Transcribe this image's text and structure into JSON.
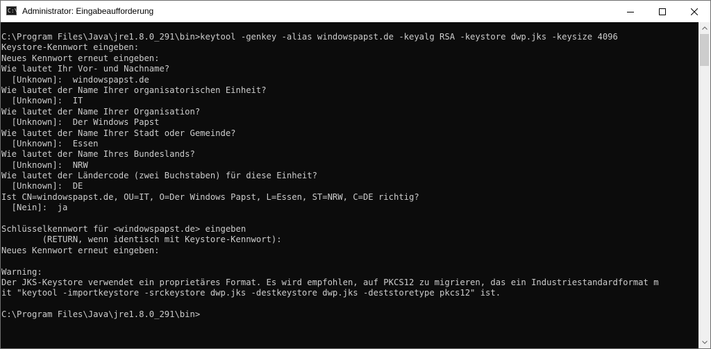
{
  "window": {
    "title": "Administrator: Eingabeaufforderung",
    "icon": "cmd-icon",
    "controls": [
      "minimize-icon",
      "maximize-icon",
      "close-icon"
    ]
  },
  "colors": {
    "console_bg": "#0c0c0c",
    "console_fg": "#cccccc",
    "titlebar_bg": "#ffffff",
    "scrollbar_bg": "#f0f0f0",
    "scrollbar_thumb": "#cdcdcd"
  },
  "console": {
    "lines": [
      "C:\\Program Files\\Java\\jre1.8.0_291\\bin>keytool -genkey -alias windowspapst.de -keyalg RSA -keystore dwp.jks -keysize 4096",
      "Keystore-Kennwort eingeben:",
      "Neues Kennwort erneut eingeben:",
      "Wie lautet Ihr Vor- und Nachname?",
      "  [Unknown]:  windowspapst.de",
      "Wie lautet der Name Ihrer organisatorischen Einheit?",
      "  [Unknown]:  IT",
      "Wie lautet der Name Ihrer Organisation?",
      "  [Unknown]:  Der Windows Papst",
      "Wie lautet der Name Ihrer Stadt oder Gemeinde?",
      "  [Unknown]:  Essen",
      "Wie lautet der Name Ihres Bundeslands?",
      "  [Unknown]:  NRW",
      "Wie lautet der Ländercode (zwei Buchstaben) für diese Einheit?",
      "  [Unknown]:  DE",
      "Ist CN=windowspapst.de, OU=IT, O=Der Windows Papst, L=Essen, ST=NRW, C=DE richtig?",
      "  [Nein]:  ja",
      "",
      "Schlüsselkennwort für <windowspapst.de> eingeben",
      "        (RETURN, wenn identisch mit Keystore-Kennwort):",
      "Neues Kennwort erneut eingeben:",
      "",
      "Warning:",
      "Der JKS-Keystore verwendet ein proprietäres Format. Es wird empfohlen, auf PKCS12 zu migrieren, das ein Industriestandardformat m",
      "it \"keytool -importkeystore -srckeystore dwp.jks -destkeystore dwp.jks -deststoretype pkcs12\" ist.",
      "",
      "C:\\Program Files\\Java\\jre1.8.0_291\\bin>"
    ]
  }
}
